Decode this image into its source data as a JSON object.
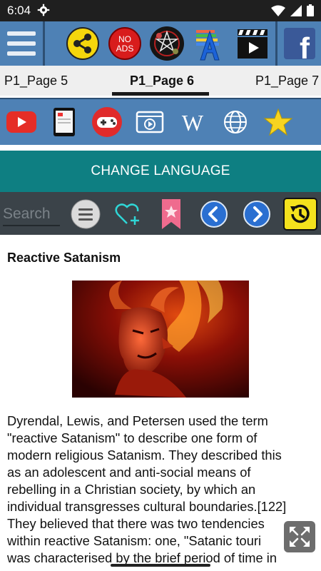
{
  "status_bar": {
    "time": "6:04"
  },
  "toolbar": {
    "menu_icon": "hamburger-menu-icon",
    "share_icon": "share-icon",
    "no_ads_label": "NO\nADS",
    "no_ads_line1": "NO",
    "no_ads_line2": "ADS",
    "app_icon": "pentagram-app-icon",
    "font_icon": "font-size-icon",
    "video_icon": "video-clapper-icon",
    "facebook_icon": "facebook-icon",
    "facebook_letter": "f"
  },
  "tabs": [
    {
      "label": "P1_Page 5",
      "active": false
    },
    {
      "label": "P1_Page 6",
      "active": true
    },
    {
      "label": "P1_Page 7",
      "active": false
    }
  ],
  "icon_row": {
    "items": [
      "youtube-icon",
      "tablet-icon",
      "gamepad-icon",
      "video-player-icon",
      "wikipedia-icon",
      "globe-icon",
      "star-icon"
    ],
    "wikipedia_letter": "W"
  },
  "change_language_label": "CHANGE LANGUAGE",
  "search": {
    "placeholder": "Search"
  },
  "nav_row": {
    "items": [
      "list-menu-icon",
      "add-favorite-icon",
      "bookmark-icon",
      "previous-icon",
      "next-icon",
      "history-icon"
    ]
  },
  "article": {
    "title": "Reactive Satanism",
    "image_alt": "demon-illustration",
    "lines": [
      "Dyrendal, Lewis, and Petersen used the term",
      "\"reactive Satanism\" to describe one form of",
      "modern religious Satanism. They described this",
      "as an adolescent and anti-social means of",
      "rebelling in a Christian society, by which an",
      "individual transgresses cultural boundaries.[122]",
      "They believed that there was two tendencies",
      "within reactive Satanism: one, \"Satanic touri",
      "was characterised by the brief period of time in"
    ]
  },
  "colors": {
    "toolbar_bg": "#4e81b5",
    "language_bg": "#0e7f82",
    "nav_bg": "#3b4349",
    "status_bg": "#1f1f1f"
  }
}
